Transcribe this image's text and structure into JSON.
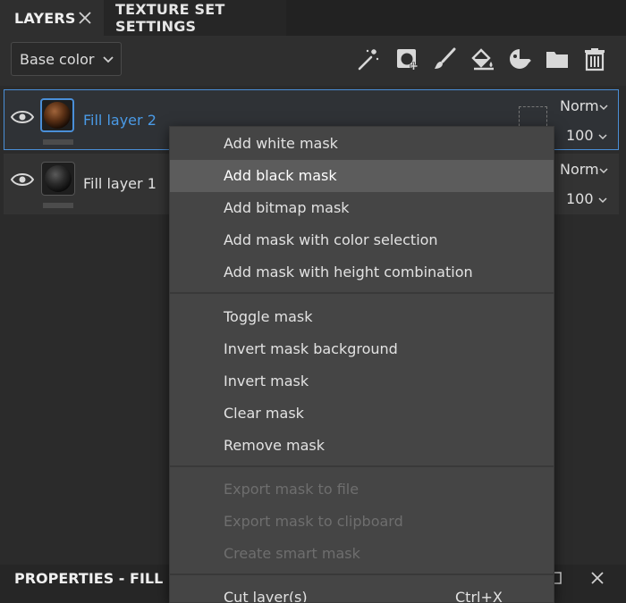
{
  "tabs": {
    "layers": "LAYERS",
    "texture_set": "TEXTURE SET SETTINGS"
  },
  "toolbar": {
    "channel": "Base color",
    "icons": [
      "magic-wand-icon",
      "add-mask-icon",
      "brush-icon",
      "fill-bucket-icon",
      "smart-material-icon",
      "folder-icon",
      "trash-icon"
    ]
  },
  "layers": [
    {
      "name": "Fill layer 2",
      "blend": "Norm",
      "opacity": "100",
      "selected": true
    },
    {
      "name": "Fill layer 1",
      "blend": "Norm",
      "opacity": "100",
      "selected": false
    }
  ],
  "properties": {
    "title": "PROPERTIES - FILL"
  },
  "menu": {
    "items": [
      {
        "label": "Add white mask"
      },
      {
        "label": "Add black mask",
        "highlighted": true
      },
      {
        "label": "Add bitmap mask"
      },
      {
        "label": "Add mask with color selection"
      },
      {
        "label": "Add mask with height combination"
      },
      {
        "label": "Toggle mask"
      },
      {
        "label": "Invert mask background"
      },
      {
        "label": "Invert mask"
      },
      {
        "label": "Clear mask"
      },
      {
        "label": "Remove mask"
      },
      {
        "label": "Export mask to file",
        "disabled": true
      },
      {
        "label": "Export mask to clipboard",
        "disabled": true
      },
      {
        "label": "Create smart mask",
        "disabled": true
      },
      {
        "label": "Cut layer(s)",
        "shortcut": "Ctrl+X"
      }
    ]
  },
  "colors": {
    "accent": "#4a8fd8",
    "panel": "#2b2b2b",
    "menu": "#454545",
    "menu_highlight": "#5c5c5c"
  }
}
